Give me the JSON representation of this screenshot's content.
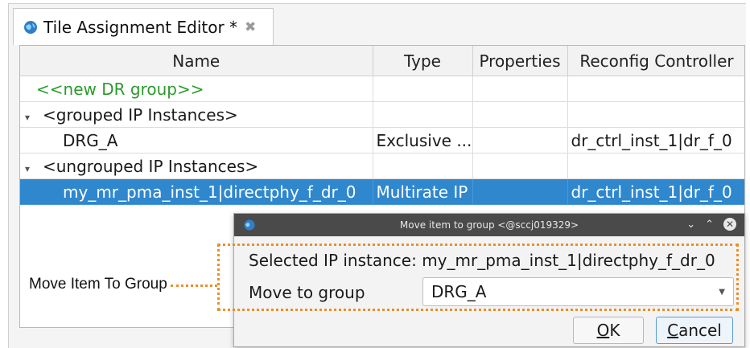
{
  "tab": {
    "title": "Tile Assignment Editor *",
    "close_glyph": "✖",
    "icon": "globe-icon"
  },
  "table": {
    "columns": [
      "Name",
      "Type",
      "Properties",
      "Reconfig Controller"
    ],
    "rows": [
      {
        "name": "<<new DR group>>",
        "type": "",
        "properties": "",
        "controller": ""
      },
      {
        "name": "<grouped IP Instances>",
        "type": "",
        "properties": "",
        "controller": ""
      },
      {
        "name": "DRG_A",
        "type": "Exclusive ...",
        "properties": "",
        "controller": "dr_ctrl_inst_1|dr_f_0"
      },
      {
        "name": "<ungrouped IP Instances>",
        "type": "",
        "properties": "",
        "controller": ""
      },
      {
        "name": "my_mr_pma_inst_1|directphy_f_dr_0",
        "type": "Multirate IP",
        "properties": "",
        "controller": "dr_ctrl_inst_1|dr_f_0"
      }
    ],
    "expander_glyph": "▾"
  },
  "dialog": {
    "title": "Move item to group <@sccj019329>",
    "selected_text": "Selected IP instance: my_mr_pma_inst_1|directphy_f_dr_0",
    "move_label": "Move to group",
    "move_value": "DRG_A",
    "ok_label": "K",
    "ok_mnemonic": "O",
    "cancel_label": "ancel",
    "cancel_mnemonic": "C",
    "ctrl_min": "⌄",
    "ctrl_max": "⌃",
    "ctrl_close": "✕"
  },
  "annotation": {
    "label": "Move Item To Group",
    "color": "#e8902a"
  },
  "colors": {
    "selection": "#2f87ce",
    "new_group": "#2c9a2c",
    "titlebar": "#4a4a4a"
  }
}
